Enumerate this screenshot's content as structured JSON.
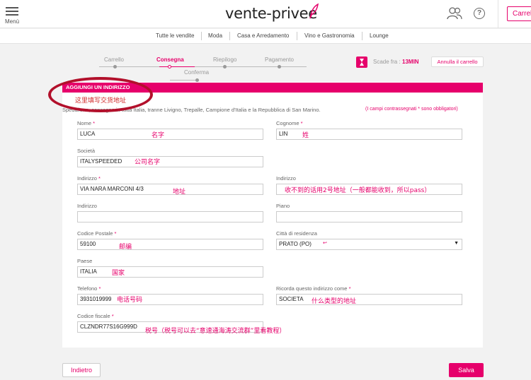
{
  "header": {
    "menu_label": "Menù",
    "logo_text": "vente-privee",
    "cart_label": "Carrell"
  },
  "nav": {
    "items": [
      {
        "label": "Tutte le vendite"
      },
      {
        "label": "Moda"
      },
      {
        "label": "Casa e Arredamento"
      },
      {
        "label": "Vino e Gastronomia"
      },
      {
        "label": "Lounge"
      }
    ]
  },
  "steps": {
    "items": [
      {
        "label": "Carrello",
        "active": false
      },
      {
        "label": "Consegna",
        "active": true
      },
      {
        "label": "Riepilogo",
        "active": false
      },
      {
        "label": "Pagamento",
        "active": false
      },
      {
        "label": "Conferma",
        "active": false
      }
    ]
  },
  "timer": {
    "label": "Scade fra :",
    "value": "13MIN",
    "cancel_label": "Annulla il carrello"
  },
  "form": {
    "section_title": "AGGIUNGI UN INDIRIZZO",
    "notice": "Spedizione, consegna in tutta Italia, tranne Livigno, Trepalle, Campione d'Italia e la Repubblica di San Marino.",
    "required_note": "(I campi contrassegnati * sono obbligatori)",
    "fields": {
      "nome": {
        "label": "Nome",
        "required": "*",
        "value": "LUCA"
      },
      "cognome": {
        "label": "Cognome",
        "required": "*",
        "value": "LIN"
      },
      "societa": {
        "label": "Società",
        "value": "ITALYSPEEDED"
      },
      "indirizzo": {
        "label": "Indirizzo",
        "required": "*",
        "value": "VIA NARA MARCONI 4/3"
      },
      "indirizzo2": {
        "label": "Indirizzo",
        "value": ""
      },
      "indirizzo3": {
        "label": "Indirizzo",
        "value": ""
      },
      "piano": {
        "label": "Piano",
        "value": ""
      },
      "cap": {
        "label": "Codice Postale",
        "required": "*",
        "value": "59100"
      },
      "citta": {
        "label": "Città di residenza",
        "value": "PRATO (PO)"
      },
      "paese": {
        "label": "Paese",
        "value": "ITALIA"
      },
      "telefono": {
        "label": "Telefono",
        "required": "*",
        "value": "3931019999"
      },
      "ricorda": {
        "label": "Ricorda questo indirizzo come",
        "required": "*",
        "value": "SOCIETA"
      },
      "codice_fiscale": {
        "label": "Codice fiscale",
        "required": "*",
        "value": "CLZNDR77S16G999D"
      }
    },
    "back_label": "Indietro",
    "save_label": "Salva"
  },
  "annotations": {
    "fill_here": "这里填写交货地址",
    "first_name": "名字",
    "last_name": "姓",
    "company": "公司名字",
    "address": "地址",
    "address2": "收不到的话用2号地址（一般都能收到，所以pass）",
    "zip": "邮编",
    "city_mark": "↩",
    "country": "国家",
    "phone": "电话号码",
    "remember": "什么类型的地址",
    "tax": "税号（税号可以去“意速通海涛交流群”里看教程）"
  },
  "colors": {
    "accent": "#e6006b",
    "annotation_ring": "#b2102b"
  }
}
